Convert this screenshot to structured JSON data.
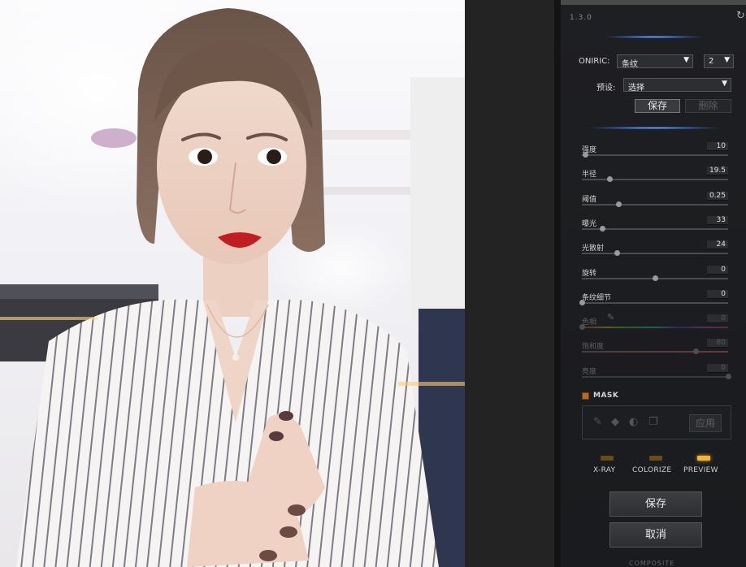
{
  "version": "1.3.0",
  "oniric": {
    "label": "ONIRIC:",
    "mode_value": "条纹",
    "count_value": "2"
  },
  "preset": {
    "label": "预设:",
    "value": "选择",
    "save_label": "保存",
    "delete_label": "删除"
  },
  "sliders": [
    {
      "label": "强度",
      "value": "10",
      "fraction": 0.02,
      "enabled": true
    },
    {
      "label": "半径",
      "value": "19.5",
      "fraction": 0.19,
      "enabled": true
    },
    {
      "label": "阈值",
      "value": "0.25",
      "fraction": 0.25,
      "enabled": true
    },
    {
      "label": "曝光",
      "value": "33",
      "fraction": 0.14,
      "enabled": true
    },
    {
      "label": "光散射",
      "value": "24",
      "fraction": 0.24,
      "enabled": true
    },
    {
      "label": "旋转",
      "value": "0",
      "fraction": 0.5,
      "enabled": true
    },
    {
      "label": "条纹细节",
      "value": "0",
      "fraction": 0.0,
      "enabled": true
    },
    {
      "label": "色相",
      "value": "0",
      "fraction": 0.0,
      "enabled": false
    },
    {
      "label": "饱和度",
      "value": "80",
      "fraction": 0.78,
      "enabled": false
    },
    {
      "label": "亮度",
      "value": "0",
      "fraction": 1.0,
      "enabled": false
    }
  ],
  "mask": {
    "label": "MASK",
    "enabled": true,
    "apply_label": "应用"
  },
  "modes": [
    {
      "label": "X-RAY",
      "active": false
    },
    {
      "label": "COLORIZE",
      "active": false
    },
    {
      "label": "PREVIEW",
      "active": true
    }
  ],
  "footer": {
    "save_label": "保存",
    "cancel_label": "取消",
    "composite_label": "COMPOSITE"
  },
  "colors": {
    "panel_bg": "#1e1f22",
    "accent_glow": "#3b6fd8",
    "led_on": "#f2b63a",
    "mask_check": "#b86a1e"
  }
}
